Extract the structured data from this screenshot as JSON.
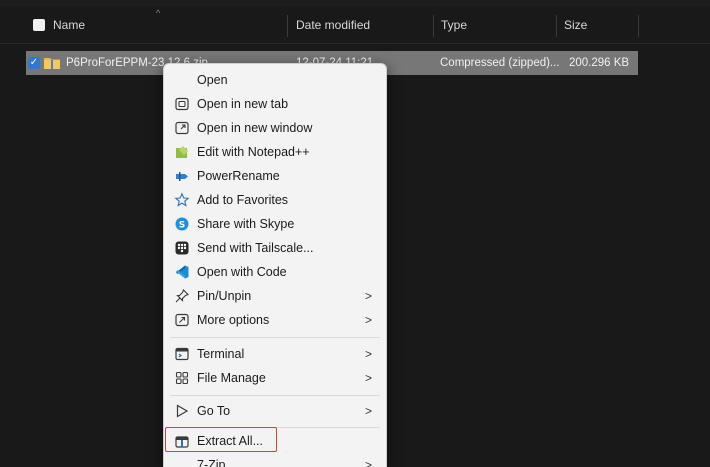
{
  "header": {
    "name_label": "Name",
    "date_label": "Date modified",
    "type_label": "Type",
    "size_label": "Size"
  },
  "file": {
    "name": "P6ProForEPPM-23.12.6.zip",
    "date": "12-07-24 11:21",
    "type": "Compressed (zipped)...",
    "size": "200.296 KB"
  },
  "menu": {
    "items": [
      {
        "label": "Open",
        "icon": "none"
      },
      {
        "label": "Open in new tab",
        "icon": "new-tab-icon"
      },
      {
        "label": "Open in new window",
        "icon": "new-window-icon"
      },
      {
        "label": "Edit with Notepad++",
        "icon": "notepad-plus-plus-icon"
      },
      {
        "label": "PowerRename",
        "icon": "power-rename-icon"
      },
      {
        "label": "Add to Favorites",
        "icon": "star-icon"
      },
      {
        "label": "Share with Skype",
        "icon": "skype-icon"
      },
      {
        "label": "Send with Tailscale...",
        "icon": "tailscale-icon"
      },
      {
        "label": "Open with Code",
        "icon": "vscode-icon"
      },
      {
        "label": "Pin/Unpin",
        "icon": "pin-icon"
      },
      {
        "label": "More options",
        "icon": "more-options-icon"
      },
      {
        "label": "Terminal",
        "icon": "terminal-icon"
      },
      {
        "label": "File Manage",
        "icon": "grid-icon"
      },
      {
        "label": "Go To",
        "icon": "play-outline-icon"
      },
      {
        "label": "Extract All...",
        "icon": "extract-icon"
      },
      {
        "label": "7-Zip",
        "icon": "none"
      }
    ],
    "submenu_arrow": ">"
  },
  "colors": {
    "background": "#191919",
    "selected_row": "#777777",
    "menu_background": "#f3f3f3",
    "highlight_border": "#d9412f",
    "checkbox_blue": "#2f79d3"
  }
}
